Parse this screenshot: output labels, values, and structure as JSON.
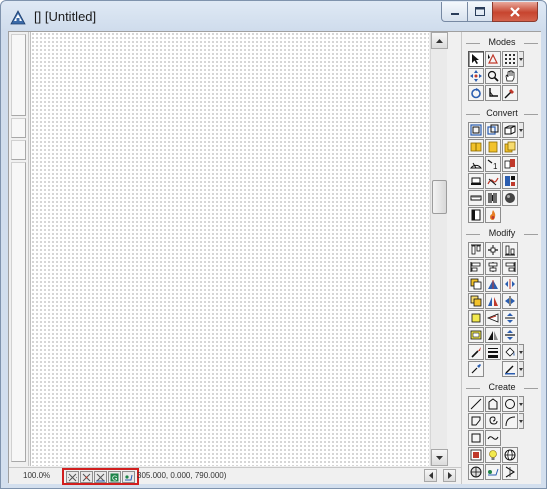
{
  "window": {
    "title": "[] [Untitled]",
    "buttons": {
      "minimize": "minimize",
      "maximize": "maximize",
      "close": "close"
    }
  },
  "status_bar": {
    "zoom": "100.0%",
    "coordinates": "305.000, 0.000, 790.000)",
    "snap_buttons": [
      "snap-grid",
      "snap-points",
      "snap-lines",
      "snap-toggle",
      "snap-view"
    ]
  },
  "toolbox": {
    "sections": {
      "modes": "Modes",
      "convert": "Convert",
      "modify": "Modify",
      "create": "Create"
    }
  },
  "colors": {
    "accent_red": "#d11f1f",
    "canvas_dots": "#6b6b6b"
  }
}
